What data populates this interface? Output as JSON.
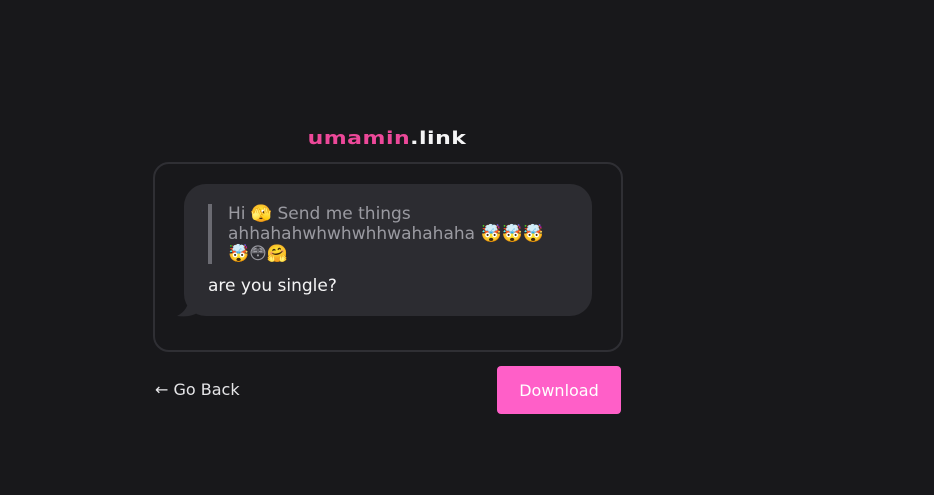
{
  "logo": {
    "brand": "umamin",
    "tld": ".link"
  },
  "card": {
    "quote": "Hi 🫣 Send me things\nahhahahwhwhwhhwahahaha 🤯🤯🤯\n🤯😳🤗",
    "message": "are you single?"
  },
  "actions": {
    "go_back_label": "← Go Back",
    "download_label": "Download"
  },
  "colors": {
    "background": "#18181b",
    "brand_pink": "#ec4899",
    "button_pink": "#ff5fc8",
    "bubble": "#2c2c31"
  }
}
